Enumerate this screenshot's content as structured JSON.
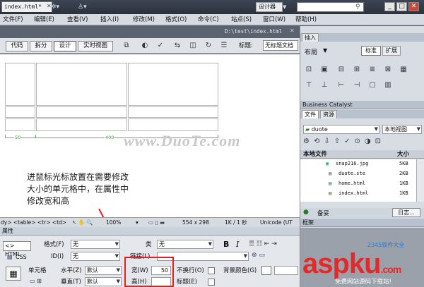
{
  "app": {
    "logo": "Dw",
    "designer_label": "设计器",
    "win_buttons": [
      "_",
      "□",
      "✕"
    ]
  },
  "menu": [
    "文件(F)",
    "编辑(E)",
    "查看(V)",
    "插入(I)",
    "修改(M)",
    "格式(O)",
    "命令(C)",
    "站点(S)",
    "窗口(W)",
    "帮助(H)"
  ],
  "document": {
    "tab": "index.html*",
    "path": "D:\\test\\index.html"
  },
  "view_toolbar": {
    "buttons": [
      "代码",
      "拆分",
      "设计",
      "实时视图"
    ],
    "active": "设计",
    "title_label": "标题:",
    "title_value": "无标题文档"
  },
  "rulers": {
    "left_width": "50",
    "total_width": "400"
  },
  "watermark": "www.DuoTe.com",
  "annotation": [
    "进鼠标光标放置在需要修改",
    "大小的单元格中，在属性中",
    "修改宽和高"
  ],
  "status": {
    "tags": "dy> <table> <tr> <td>",
    "zoom": "100%",
    "size": "554 x 298",
    "speed": "1K / 1 秒",
    "encoding": "Unicode (UT"
  },
  "properties": {
    "header": "属性",
    "html_btn": "<> HTML",
    "css_btn": "CSS",
    "format_label": "格式(F)",
    "format_value": "无",
    "class_label": "类",
    "class_value": "无",
    "id_label": "ID(I)",
    "id_value": "无",
    "link_label": "链接(L)",
    "cell_label": "单元格",
    "horz_label": "水平(Z)",
    "horz_value": "默认",
    "vert_label": "垂直(T)",
    "vert_value": "默认",
    "width_label": "宽(W)",
    "width_value": "50",
    "height_label": "高(H)",
    "height_value": "",
    "nowrap_label": "不换行(O)",
    "header_label": "标题(E)",
    "bg_label": "背景颜色(G)",
    "bold": "B",
    "italic": "I"
  },
  "insert_panel": {
    "tab": "插入",
    "category": "布局",
    "modes": [
      "标准",
      "扩展"
    ]
  },
  "files_panel": {
    "header": "Business Catalyst",
    "tabs": [
      "文件",
      "资源"
    ],
    "site": "duote",
    "view": "本地视图",
    "col_name": "本地文件",
    "col_size": "大小",
    "rows": [
      {
        "name": "snap216.jpg",
        "size": "5KB"
      },
      {
        "name": "duote.ste",
        "size": "2KB"
      },
      {
        "name": "home.html",
        "size": "1KB"
      },
      {
        "name": "index.html",
        "size": "1KB"
      }
    ],
    "footer_left": "备妥",
    "footer_right": "日志..."
  },
  "frames_label": "框架",
  "brand": {
    "name": "aspku",
    "tld": ".com",
    "sub": "免费网站源码下载站!",
    "mid": "2345软件大全"
  }
}
